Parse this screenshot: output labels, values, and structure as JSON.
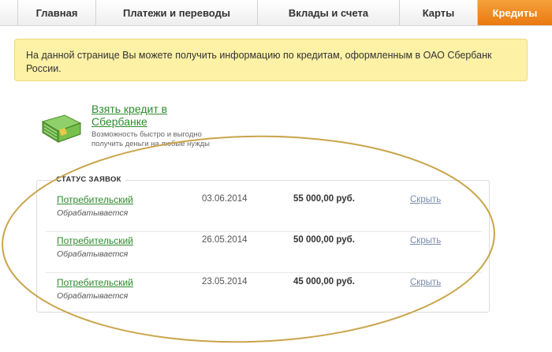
{
  "nav": {
    "tabs": [
      {
        "label": "Главная"
      },
      {
        "label": "Платежи и переводы"
      },
      {
        "label": "Вклады и счета"
      },
      {
        "label": "Карты"
      },
      {
        "label": "Кредиты",
        "active": true
      }
    ]
  },
  "notice": {
    "text": "На данной странице Вы можете получить информацию по кредитам, оформленным в ОАО Сбербанк России."
  },
  "promo": {
    "icon": "money-stack-icon",
    "link": "Взять кредит в Сбербанке",
    "description": "Возможность быстро и выгодно получить деньги на любые нужды"
  },
  "status": {
    "title": "СТАТУС ЗАЯВОК",
    "rows": [
      {
        "name": "Потребительский",
        "status": "Обрабатывается",
        "date": "03.06.2014",
        "amount": "55 000,00 руб.",
        "action": "Скрыть"
      },
      {
        "name": "Потребительский",
        "status": "Обрабатывается",
        "date": "26.05.2014",
        "amount": "50 000,00 руб.",
        "action": "Скрыть"
      },
      {
        "name": "Потребительский",
        "status": "Обрабатывается",
        "date": "23.05.2014",
        "amount": "45 000,00 руб.",
        "action": "Скрыть"
      }
    ]
  },
  "colors": {
    "accent": "#ee8416",
    "link": "#2e8b2e",
    "notice_bg": "#fdf1a6",
    "annotation": "#c9a44a"
  }
}
